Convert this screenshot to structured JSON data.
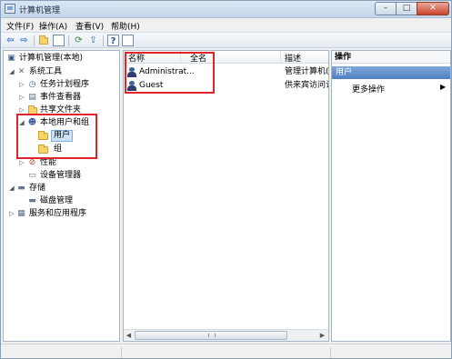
{
  "window": {
    "title": "计算机管理",
    "minimize": "–",
    "maximize": "□",
    "close": "✕"
  },
  "menu": [
    {
      "label": "文件(F)"
    },
    {
      "label": "操作(A)"
    },
    {
      "label": "查看(V)"
    },
    {
      "label": "帮助(H)"
    }
  ],
  "toolbar": {
    "back": "⇦",
    "forward": "⇨"
  },
  "tree": {
    "root": "计算机管理(本地)",
    "system_tools": "系统工具",
    "task_scheduler": "任务计划程序",
    "event_viewer": "事件查看器",
    "shared_folders": "共享文件夹",
    "local_users_groups": "本地用户和组",
    "users": "用户",
    "groups": "组",
    "performance": "性能",
    "device_manager": "设备管理器",
    "storage": "存储",
    "disk_management": "磁盘管理",
    "services_apps": "服务和应用程序"
  },
  "list": {
    "columns": [
      "名称",
      "全名",
      "描述"
    ],
    "rows": [
      {
        "name": "Administrat...",
        "fullname": "",
        "desc": "管理计算机(域"
      },
      {
        "name": "Guest",
        "fullname": "",
        "desc": "供来宾访问计"
      }
    ]
  },
  "actions": {
    "header": "操作",
    "section": "用户",
    "more": "更多操作",
    "arrow": "▶"
  },
  "colors": {
    "highlight_red": "#e0242a",
    "selection": "#cde3f8",
    "action_section": "#4f7fbf"
  }
}
